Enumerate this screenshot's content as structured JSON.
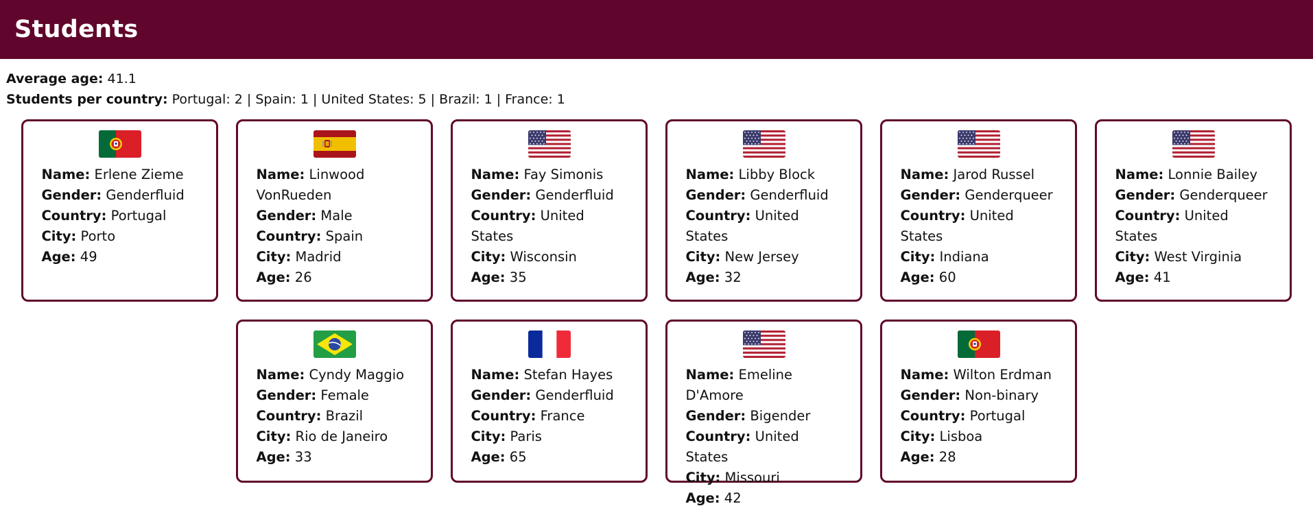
{
  "header": {
    "title": "Students"
  },
  "stats": {
    "avg_label": "Average age:",
    "avg_value": "41.1",
    "per_country_label": "Students per country:",
    "per_country_value": "Portugal: 2 | Spain: 1 | United States: 5 | Brazil: 1 | France: 1"
  },
  "labels": {
    "name": "Name:",
    "gender": "Gender:",
    "country": "Country:",
    "city": "City:",
    "age": "Age:"
  },
  "students": [
    {
      "flag": "portugal-flag",
      "name": "Erlene Zieme",
      "gender": "Genderfluid",
      "country": "Portugal",
      "city": "Porto",
      "age": "49"
    },
    {
      "flag": "spain-flag",
      "name": "Linwood VonRueden",
      "gender": "Male",
      "country": "Spain",
      "city": "Madrid",
      "age": "26"
    },
    {
      "flag": "united-states-flag",
      "name": "Fay Simonis",
      "gender": "Genderfluid",
      "country": "United States",
      "city": "Wisconsin",
      "age": "35"
    },
    {
      "flag": "united-states-flag",
      "name": "Libby Block",
      "gender": "Genderfluid",
      "country": "United States",
      "city": "New Jersey",
      "age": "32"
    },
    {
      "flag": "united-states-flag",
      "name": "Jarod Russel",
      "gender": "Genderqueer",
      "country": "United States",
      "city": "Indiana",
      "age": "60"
    },
    {
      "flag": "united-states-flag",
      "name": "Lonnie Bailey",
      "gender": "Genderqueer",
      "country": "United States",
      "city": "West Virginia",
      "age": "41"
    },
    {
      "flag": "brazil-flag",
      "name": "Cyndy Maggio",
      "gender": "Female",
      "country": "Brazil",
      "city": "Rio de Janeiro",
      "age": "33"
    },
    {
      "flag": "france-flag",
      "name": "Stefan Hayes",
      "gender": "Genderfluid",
      "country": "France",
      "city": "Paris",
      "age": "65"
    },
    {
      "flag": "united-states-flag",
      "name": "Emeline D'Amore",
      "gender": "Bigender",
      "country": "United States",
      "city": "Missouri",
      "age": "42"
    },
    {
      "flag": "portugal-flag",
      "name": "Wilton Erdman",
      "gender": "Non-binary",
      "country": "Portugal",
      "city": "Lisboa",
      "age": "28"
    }
  ]
}
